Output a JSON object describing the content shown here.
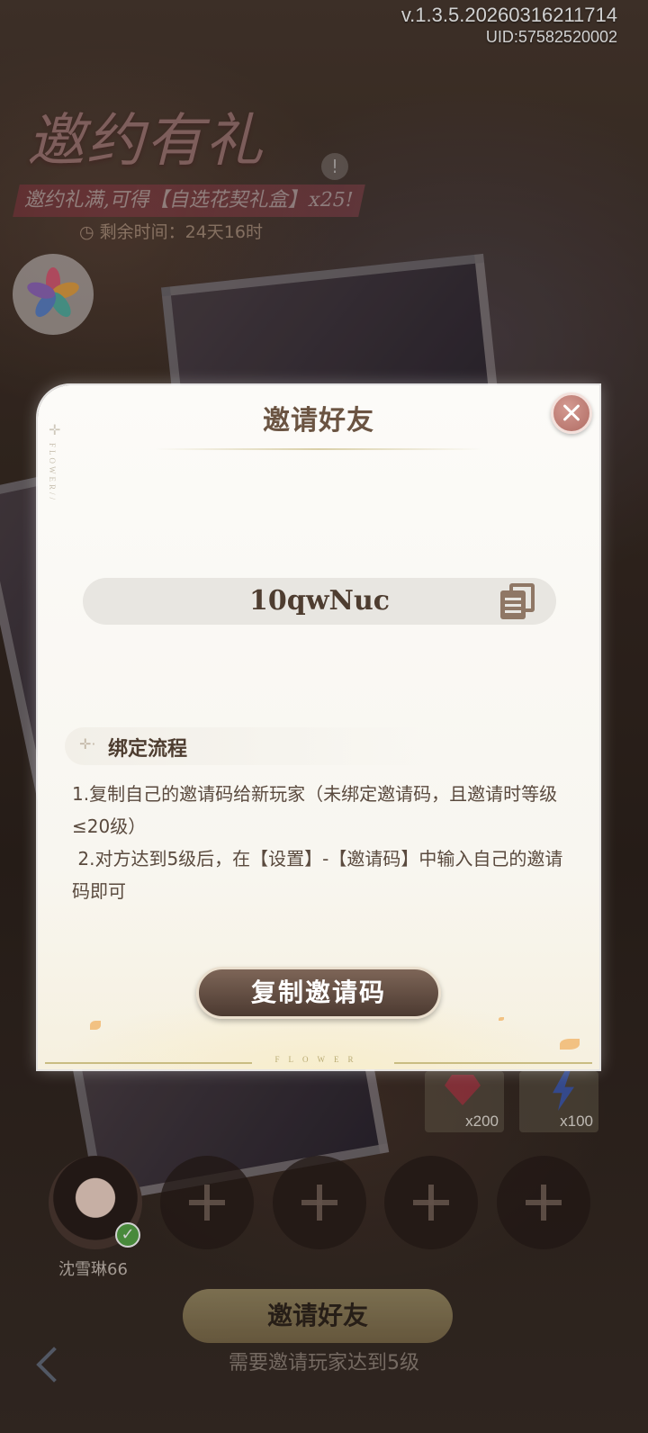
{
  "version": "v.1.3.5.20260316211714",
  "uid": "UID:57582520002",
  "event": {
    "title": "邀约有礼",
    "subtitle": "邀约礼满,可得【自选花契礼盒】x25!",
    "time_remaining": "◷ 剩余时间：24天16时"
  },
  "modal": {
    "title": "邀请好友",
    "invite_code": "10qwNuc",
    "bind_section_title": "绑定流程",
    "step1": "1.复制自己的邀请码给新玩家（未绑定邀请码，且邀请时等级≤20级）",
    "step2": " 2.对方达到5级后，在【设置】-【邀请码】中输入自己的邀请码即可",
    "copy_button": "复制邀请码",
    "deco_vertical": "FLOWER//",
    "deco_footer": "FLOWER"
  },
  "rewards": [
    {
      "icon": "gem-icon",
      "count": "x200"
    },
    {
      "icon": "energy-bolt-icon",
      "count": "x100"
    }
  ],
  "player": {
    "name": "沈雪琳66"
  },
  "invite_friends_button": "邀请好友",
  "requirement_text": "需要邀请玩家达到5级"
}
